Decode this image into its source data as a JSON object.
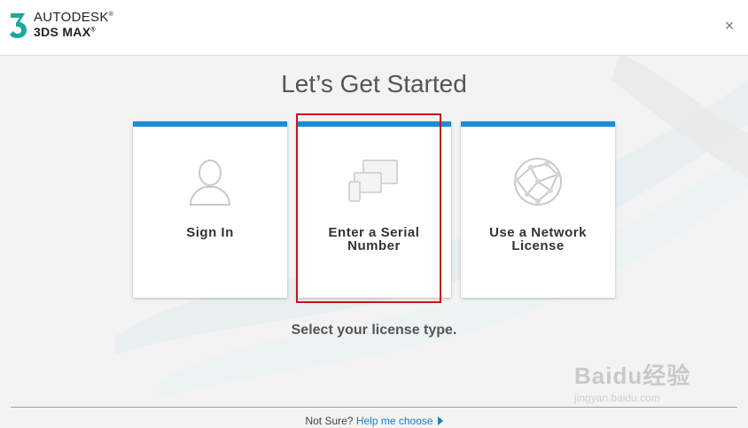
{
  "header": {
    "brand_line1": "AUTODESK",
    "brand_line2": "3DS MAX",
    "logo_text": "3",
    "close_glyph": "×"
  },
  "main": {
    "title": "Let’s Get Started",
    "cards": [
      {
        "label_line1": "Sign In",
        "label_line2": "",
        "icon": "user-silhouette-icon"
      },
      {
        "label_line1": "Enter a Serial",
        "label_line2": "Number",
        "icon": "devices-icon"
      },
      {
        "label_line1": "Use a Network",
        "label_line2": "License",
        "icon": "globe-network-icon"
      }
    ],
    "subtitle": "Select your license type."
  },
  "footer": {
    "prefix": "Not Sure?",
    "link": "Help me choose"
  },
  "watermark": {
    "text": "Baidu经验",
    "sub": "jingyan.baidu.com"
  },
  "colors": {
    "accent": "#1a8dd6",
    "highlight": "#c8151b",
    "logo": "#1aa89a"
  }
}
